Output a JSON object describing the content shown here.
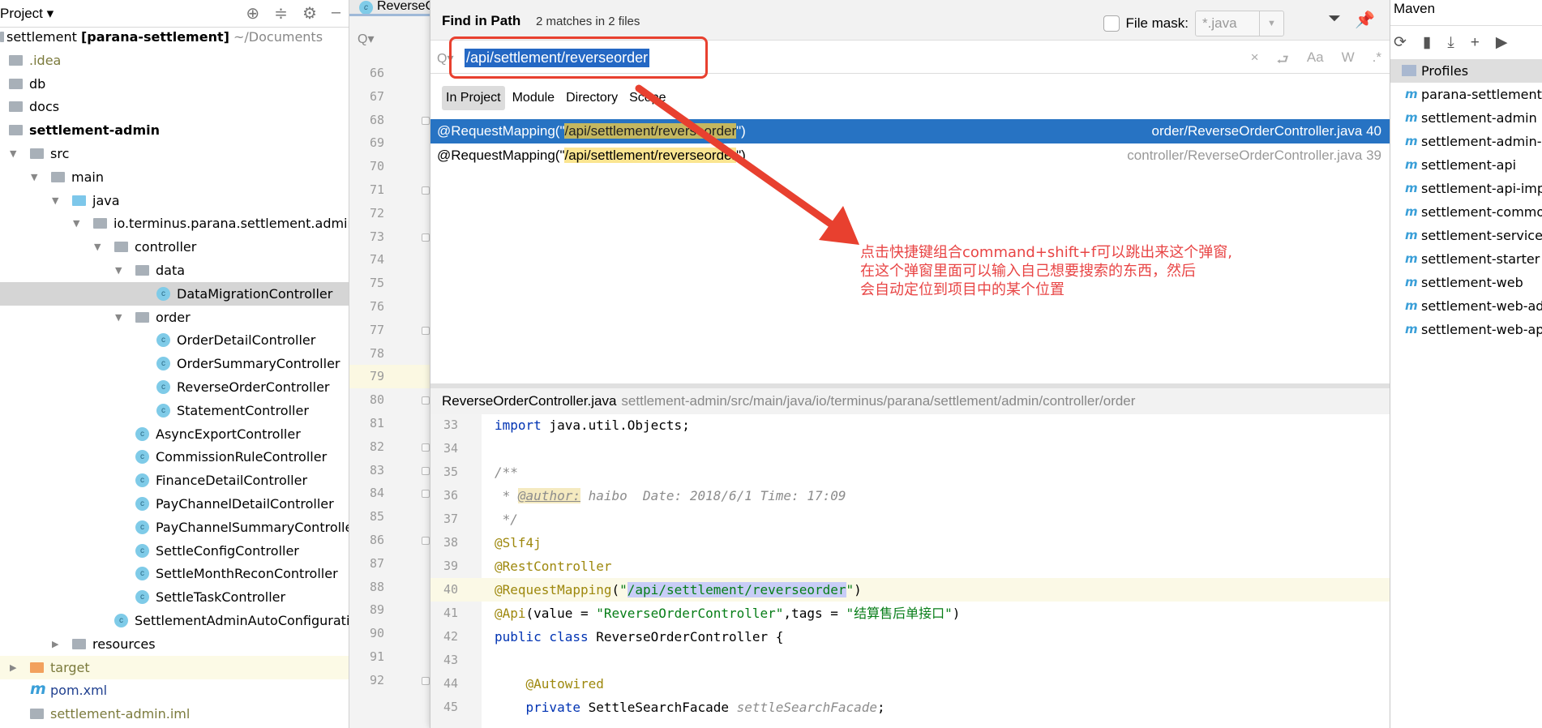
{
  "project_panel": {
    "title": "Project ▾",
    "tree": [
      {
        "label": "settlement [parana-settlement]",
        "suffix": "~/Documents",
        "depth": 0,
        "icon": "module-icon",
        "expanded": true,
        "style": "root"
      },
      {
        "label": ".idea",
        "depth": 1,
        "icon": "folder-icon",
        "style": "olive"
      },
      {
        "label": "db",
        "depth": 1,
        "icon": "folder-icon"
      },
      {
        "label": "docs",
        "depth": 1,
        "icon": "folder-icon"
      },
      {
        "label": "settlement-admin",
        "depth": 1,
        "icon": "module-icon",
        "style": "bold"
      },
      {
        "label": "src",
        "depth": 2,
        "icon": "folder-icon",
        "expanded": true
      },
      {
        "label": "main",
        "depth": 3,
        "icon": "folder-icon",
        "expanded": true
      },
      {
        "label": "java",
        "depth": 4,
        "icon": "source-folder-icon",
        "expanded": true
      },
      {
        "label": "io.terminus.parana.settlement.admin",
        "depth": 5,
        "icon": "package-icon",
        "expanded": true
      },
      {
        "label": "controller",
        "depth": 6,
        "icon": "package-icon",
        "expanded": true
      },
      {
        "label": "data",
        "depth": 7,
        "icon": "package-icon",
        "expanded": true
      },
      {
        "label": "DataMigrationController",
        "depth": 8,
        "icon": "class-icon",
        "selected": true
      },
      {
        "label": "order",
        "depth": 7,
        "icon": "package-icon",
        "expanded": true
      },
      {
        "label": "OrderDetailController",
        "depth": 8,
        "icon": "class-icon"
      },
      {
        "label": "OrderSummaryController",
        "depth": 8,
        "icon": "class-icon"
      },
      {
        "label": "ReverseOrderController",
        "depth": 8,
        "icon": "class-icon"
      },
      {
        "label": "StatementController",
        "depth": 8,
        "icon": "class-icon"
      },
      {
        "label": "AsyncExportController",
        "depth": 7,
        "icon": "class-icon"
      },
      {
        "label": "CommissionRuleController",
        "depth": 7,
        "icon": "class-icon"
      },
      {
        "label": "FinanceDetailController",
        "depth": 7,
        "icon": "class-icon"
      },
      {
        "label": "PayChannelDetailController",
        "depth": 7,
        "icon": "class-icon"
      },
      {
        "label": "PayChannelSummaryController",
        "depth": 7,
        "icon": "class-icon"
      },
      {
        "label": "SettleConfigController",
        "depth": 7,
        "icon": "class-icon"
      },
      {
        "label": "SettleMonthReconController",
        "depth": 7,
        "icon": "class-icon"
      },
      {
        "label": "SettleTaskController",
        "depth": 7,
        "icon": "class-icon"
      },
      {
        "label": "SettlementAdminAutoConfiguration",
        "depth": 6,
        "icon": "class-icon"
      },
      {
        "label": "resources",
        "depth": 4,
        "icon": "resources-folder-icon",
        "expanded": false
      },
      {
        "label": "target",
        "depth": 2,
        "icon": "excluded-folder-icon",
        "expanded": false,
        "style": "olive",
        "highlight": true
      },
      {
        "label": "pom.xml",
        "depth": 2,
        "icon": "maven-icon",
        "style": "navy"
      },
      {
        "label": "settlement-admin.iml",
        "depth": 2,
        "icon": "iml-icon",
        "style": "olive"
      }
    ]
  },
  "editor": {
    "tab_label": "ReverseOrderController.java",
    "gutter_lines": [
      66,
      67,
      68,
      69,
      70,
      71,
      72,
      73,
      74,
      75,
      76,
      77,
      78,
      79,
      80,
      81,
      82,
      83,
      84,
      85,
      86,
      87,
      88,
      89,
      90,
      91,
      92
    ],
    "current_line": 79
  },
  "find_dialog": {
    "title": "Find in Path",
    "match_summary": "2 matches in 2 files",
    "file_mask_label": "File mask:",
    "file_mask_checked": false,
    "file_mask_value": "*.java",
    "search_value": "/api/settlement/reverseorder",
    "scopes": [
      {
        "label": "In Project",
        "active": true
      },
      {
        "label": "Module"
      },
      {
        "label": "Directory"
      },
      {
        "label": "Scope"
      }
    ],
    "results": [
      {
        "prefix": "@RequestMapping(\"",
        "match": "/api/settlement/reverseorder",
        "suffix": "\")",
        "file": "order/ReverseOrderController.java 40",
        "selected": true
      },
      {
        "prefix": "@RequestMapping(\"",
        "match": "/api/settlement/reverseorder",
        "suffix": "\")",
        "file": "controller/ReverseOrderController.java 39"
      }
    ],
    "preview": {
      "file_name": "ReverseOrderController.java",
      "path": "settlement-admin/src/main/java/io/terminus/parana/settlement/admin/controller/order",
      "highlight_line": 40,
      "lines": [
        {
          "n": 33,
          "tokens": [
            [
              "import",
              "kw"
            ],
            [
              " java.util.Objects;",
              "pl"
            ]
          ]
        },
        {
          "n": 34,
          "tokens": []
        },
        {
          "n": 35,
          "tokens": [
            [
              "/**",
              "cmt"
            ]
          ]
        },
        {
          "n": 36,
          "tokens": [
            [
              " * ",
              "cmt"
            ],
            [
              "@author:",
              "tag"
            ],
            [
              " haibo  Date: 2018/6/1 Time: 17:09",
              "cmt"
            ]
          ]
        },
        {
          "n": 37,
          "tokens": [
            [
              " */",
              "cmt"
            ]
          ]
        },
        {
          "n": 38,
          "tokens": [
            [
              "@Slf4j",
              "ann"
            ]
          ]
        },
        {
          "n": 39,
          "tokens": [
            [
              "@RestController",
              "ann"
            ]
          ]
        },
        {
          "n": 40,
          "tokens": [
            [
              "@RequestMapping",
              "ann"
            ],
            [
              "(",
              "pl"
            ],
            [
              "\"",
              "str"
            ],
            [
              "/api/settlement/reverseorder",
              "str sel"
            ],
            [
              "\"",
              "str"
            ],
            [
              ")",
              "pl"
            ]
          ]
        },
        {
          "n": 41,
          "tokens": [
            [
              "@Api",
              "ann"
            ],
            [
              "(value = ",
              "pl"
            ],
            [
              "\"ReverseOrderController\"",
              "str"
            ],
            [
              ",tags = ",
              "pl"
            ],
            [
              "\"结算售后单接口\"",
              "str"
            ],
            [
              ")",
              "pl"
            ]
          ]
        },
        {
          "n": 42,
          "tokens": [
            [
              "public class",
              "kw"
            ],
            [
              " ReverseOrderController {",
              "pl"
            ]
          ]
        },
        {
          "n": 43,
          "tokens": []
        },
        {
          "n": 44,
          "tokens": [
            [
              "    @Autowired",
              "ann"
            ]
          ]
        },
        {
          "n": 45,
          "tokens": [
            [
              "    private",
              "kw"
            ],
            [
              " SettleSearchFacade ",
              "pl"
            ],
            [
              "settleSearchFacade",
              "cmt"
            ],
            [
              ";",
              "pl"
            ]
          ]
        }
      ]
    }
  },
  "maven_panel": {
    "title": "Maven",
    "items": [
      {
        "label": "Profiles",
        "icon": "profiles-icon",
        "selected": true
      },
      {
        "label": "parana-settlement",
        "icon": "maven-module-icon"
      },
      {
        "label": "settlement-admin",
        "icon": "maven-module-icon"
      },
      {
        "label": "settlement-admin-web",
        "icon": "maven-module-icon"
      },
      {
        "label": "settlement-api",
        "icon": "maven-module-icon"
      },
      {
        "label": "settlement-api-impl",
        "icon": "maven-module-icon"
      },
      {
        "label": "settlement-common",
        "icon": "maven-module-icon"
      },
      {
        "label": "settlement-service",
        "icon": "maven-module-icon"
      },
      {
        "label": "settlement-starter",
        "icon": "maven-module-icon"
      },
      {
        "label": "settlement-web",
        "icon": "maven-module-icon"
      },
      {
        "label": "settlement-web-admin",
        "icon": "maven-module-icon"
      },
      {
        "label": "settlement-web-api",
        "icon": "maven-module-icon"
      }
    ]
  },
  "annotation": {
    "color": "#e8402f",
    "lines": [
      "点击快捷键组合command+shift+f可以跳出来这个弹窗,",
      "在这个弹窗里面可以输入自己想要搜索的东西，然后",
      "会自动定位到项目中的某个位置"
    ]
  }
}
